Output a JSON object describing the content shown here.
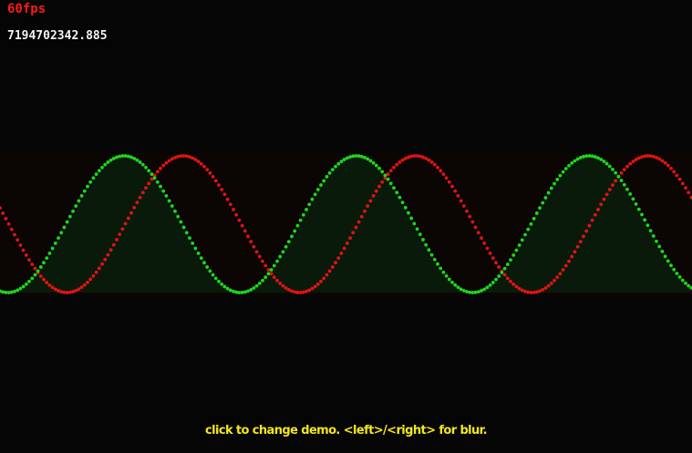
{
  "hud": {
    "fps_text": "60fps",
    "counter_text": "7194702342.885"
  },
  "footer": {
    "instructions": "click to change demo. <left>/<right> for blur."
  },
  "colors": {
    "background": "#050505",
    "fps": "#ff1a1a",
    "counter": "#f2f2f2",
    "instructions": "#f5e61a",
    "wave_green": "#1fd61f",
    "wave_red": "#e01414",
    "band": "#0b0603",
    "fill_green": "#0a1a0a"
  },
  "waves": [
    {
      "color": "#1fd61f",
      "phase": 0.0
    },
    {
      "color": "#e01414",
      "phase": 1.0
    }
  ]
}
